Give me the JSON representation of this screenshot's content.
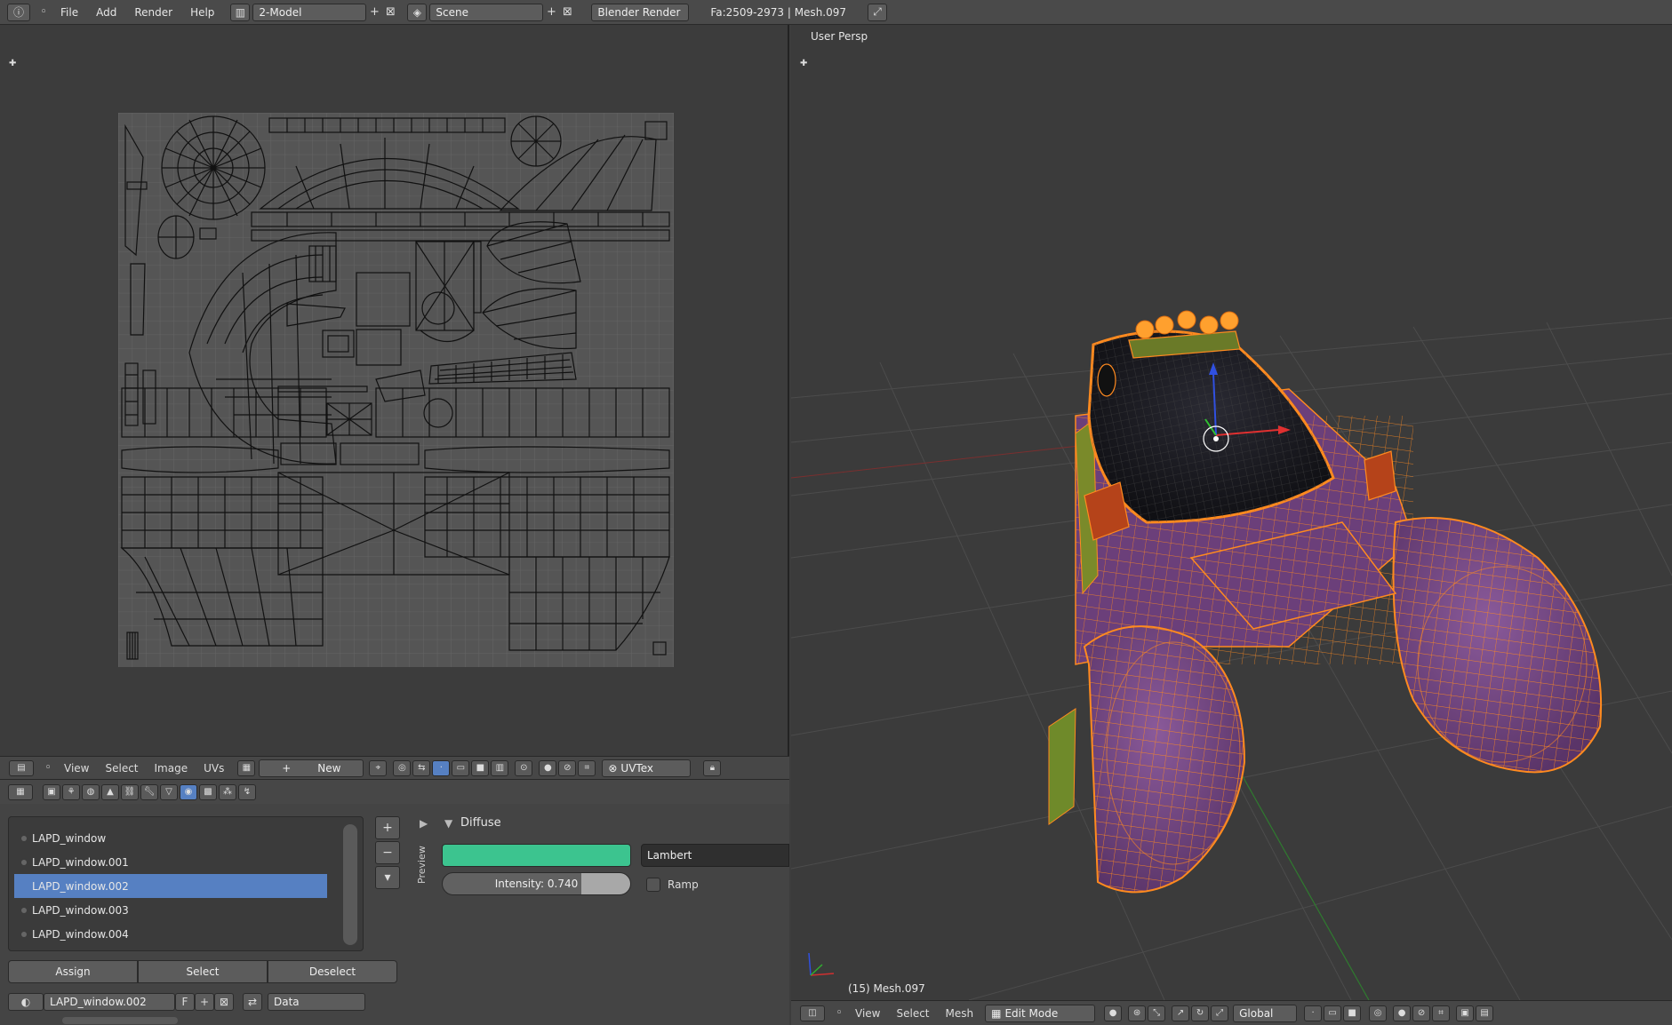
{
  "topbar": {
    "menus": [
      "File",
      "Add",
      "Render",
      "Help"
    ],
    "screen_layout": "2-Model",
    "scene": "Scene",
    "render_engine": "Blender Render",
    "stats": "Fa:2509-2973 | Mesh.097"
  },
  "uv_header": {
    "menus": [
      "View",
      "Select",
      "Image",
      "UVs"
    ],
    "new_label": "New",
    "uv_map": "UVTex"
  },
  "materials": {
    "slots": [
      "LAPD_window",
      "LAPD_window.001",
      "LAPD_window.002",
      "LAPD_window.003",
      "LAPD_window.004"
    ],
    "selected_index": 2,
    "assign_label": "Assign",
    "select_label": "Select",
    "deselect_label": "Deselect",
    "datablock_name": "LAPD_window.002",
    "fake_user": "F",
    "link_type": "Data"
  },
  "diffuse": {
    "title": "Diffuse",
    "preview_label": "Preview",
    "color": "#3cc48f",
    "shader": "Lambert",
    "intensity_label": "Intensity: 0.740",
    "intensity": 0.74,
    "ramp_label": "Ramp"
  },
  "viewport": {
    "view_name": "User Persp",
    "object_label": "(15) Mesh.097",
    "menus": [
      "View",
      "Select",
      "Mesh"
    ],
    "mode": "Edit Mode",
    "orientation": "Global"
  },
  "colors": {
    "accent": "#5680c2",
    "wire": "#ff8a1f",
    "mesh_face": "#6b3f7a",
    "glass": "#1c1c24"
  }
}
